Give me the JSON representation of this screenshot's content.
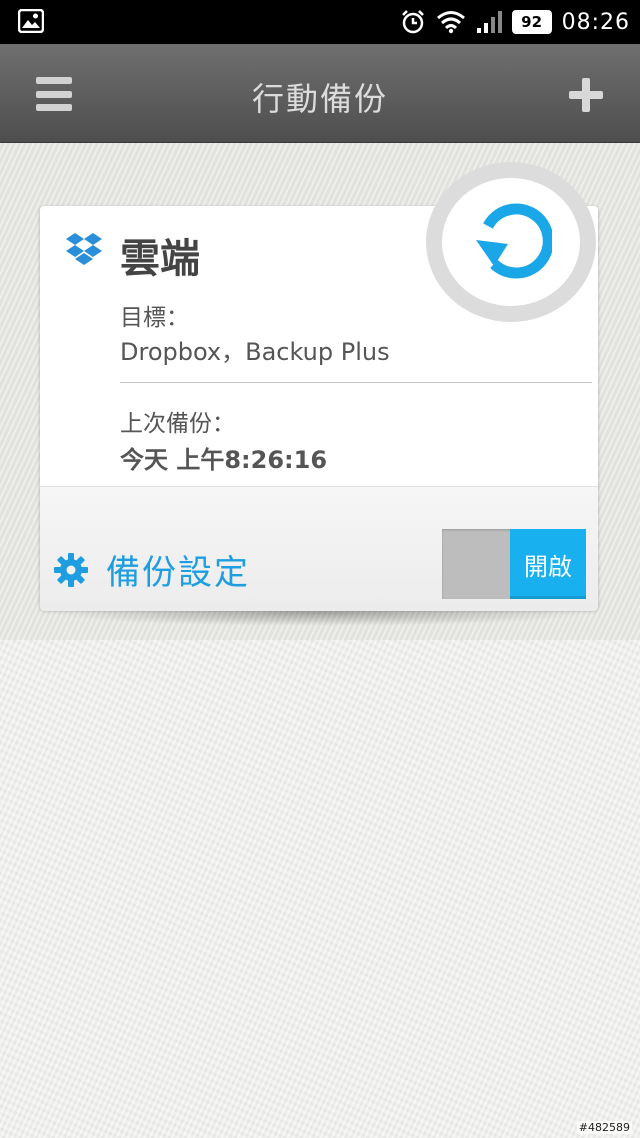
{
  "status_bar": {
    "battery": "92",
    "time": "08:26"
  },
  "action_bar": {
    "title": "行動備份"
  },
  "card": {
    "title": "雲端",
    "target_label": "目標：",
    "target_value": "Dropbox，Backup Plus",
    "last_backup_label": "上次備份：",
    "last_backup_value": "今天 上午8:26:16",
    "settings_label": "備份設定",
    "toggle_label": "開啟",
    "toggle_on": true
  },
  "watermark": "#482589",
  "colors": {
    "accent": "#18b0ef",
    "settings_text": "#1e9ee0",
    "action_bar": "#5e5e5e"
  },
  "icons": {
    "status_left": "gallery-icon",
    "status_right": [
      "alarm-icon",
      "wifi-icon",
      "signal-icon"
    ],
    "menu": "menu-icon",
    "add": "plus-icon",
    "cloud_service": "dropbox-icon",
    "sync": "sync-icon",
    "settings": "gear-icon"
  }
}
